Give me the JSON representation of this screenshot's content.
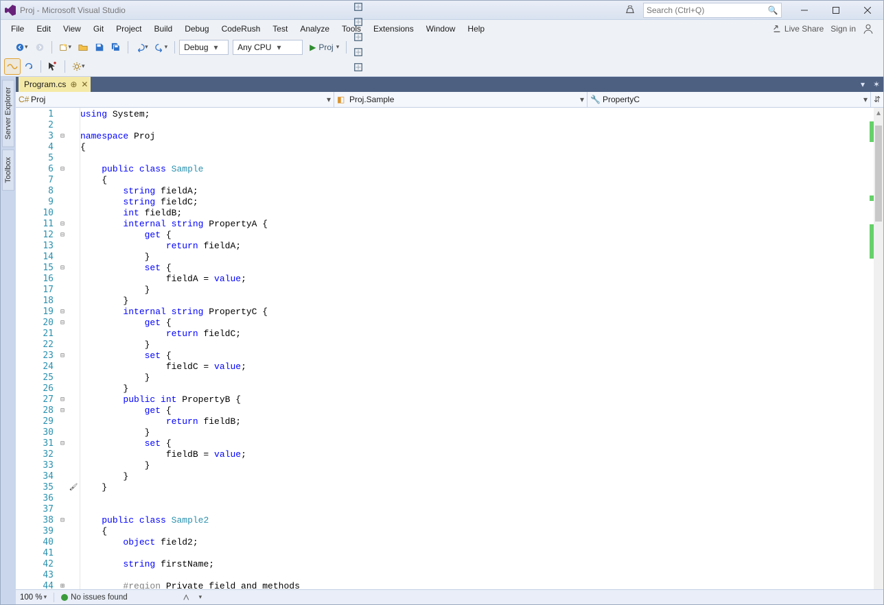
{
  "window": {
    "title": "Proj - Microsoft Visual Studio"
  },
  "titlebar": {
    "search_placeholder": "Search (Ctrl+Q)"
  },
  "menubar": {
    "items": [
      "File",
      "Edit",
      "View",
      "Git",
      "Project",
      "Build",
      "Debug",
      "CodeRush",
      "Test",
      "Analyze",
      "Tools",
      "Extensions",
      "Window",
      "Help"
    ],
    "live_share": "Live Share",
    "sign_in": "Sign in"
  },
  "toolbar": {
    "configuration": "Debug",
    "platform": "Any CPU",
    "start_label": "Proj"
  },
  "side_tabs": [
    "Server Explorer",
    "Toolbox"
  ],
  "tabs": {
    "active": "Program.cs"
  },
  "navbar": {
    "project": "Proj",
    "namespace": "Proj.Sample",
    "member": "PropertyC"
  },
  "editor": {
    "line_start": 1,
    "fold_markers": {
      "3": "-",
      "6": "-",
      "7": "",
      "11": "-",
      "12": "-",
      "15": "-",
      "19": "-",
      "20": "-",
      "23": "-",
      "27": "-",
      "28": "-",
      "31": "-",
      "38": "-",
      "44": "+"
    },
    "wand_line": 35,
    "lines": [
      [
        [
          "kw",
          "using"
        ],
        [
          "plain",
          " System;"
        ]
      ],
      [],
      [
        [
          "kw",
          "namespace"
        ],
        [
          "plain",
          " Proj"
        ]
      ],
      [
        [
          "plain",
          "{"
        ]
      ],
      [],
      [
        [
          "plain",
          "    "
        ],
        [
          "kw",
          "public"
        ],
        [
          "plain",
          " "
        ],
        [
          "kw",
          "class"
        ],
        [
          "plain",
          " "
        ],
        [
          "type",
          "Sample"
        ]
      ],
      [
        [
          "plain",
          "    {"
        ]
      ],
      [
        [
          "plain",
          "        "
        ],
        [
          "kw",
          "string"
        ],
        [
          "plain",
          " fieldA;"
        ]
      ],
      [
        [
          "plain",
          "        "
        ],
        [
          "kw",
          "string"
        ],
        [
          "plain",
          " fieldC;"
        ]
      ],
      [
        [
          "plain",
          "        "
        ],
        [
          "kw",
          "int"
        ],
        [
          "plain",
          " fieldB;"
        ]
      ],
      [
        [
          "plain",
          "        "
        ],
        [
          "kw",
          "internal"
        ],
        [
          "plain",
          " "
        ],
        [
          "kw",
          "string"
        ],
        [
          "plain",
          " PropertyA {"
        ]
      ],
      [
        [
          "plain",
          "            "
        ],
        [
          "kw",
          "get"
        ],
        [
          "plain",
          " {"
        ]
      ],
      [
        [
          "plain",
          "                "
        ],
        [
          "kw",
          "return"
        ],
        [
          "plain",
          " fieldA;"
        ]
      ],
      [
        [
          "plain",
          "            }"
        ]
      ],
      [
        [
          "plain",
          "            "
        ],
        [
          "kw",
          "set"
        ],
        [
          "plain",
          " {"
        ]
      ],
      [
        [
          "plain",
          "                fieldA = "
        ],
        [
          "kw",
          "value"
        ],
        [
          "plain",
          ";"
        ]
      ],
      [
        [
          "plain",
          "            }"
        ]
      ],
      [
        [
          "plain",
          "        }"
        ]
      ],
      [
        [
          "plain",
          "        "
        ],
        [
          "kw",
          "internal"
        ],
        [
          "plain",
          " "
        ],
        [
          "kw",
          "string"
        ],
        [
          "plain",
          " PropertyC {"
        ]
      ],
      [
        [
          "plain",
          "            "
        ],
        [
          "kw",
          "get"
        ],
        [
          "plain",
          " {"
        ]
      ],
      [
        [
          "plain",
          "                "
        ],
        [
          "kw",
          "return"
        ],
        [
          "plain",
          " fieldC;"
        ]
      ],
      [
        [
          "plain",
          "            }"
        ]
      ],
      [
        [
          "plain",
          "            "
        ],
        [
          "kw",
          "set"
        ],
        [
          "plain",
          " {"
        ]
      ],
      [
        [
          "plain",
          "                fieldC = "
        ],
        [
          "kw",
          "value"
        ],
        [
          "plain",
          ";"
        ]
      ],
      [
        [
          "plain",
          "            }"
        ]
      ],
      [
        [
          "plain",
          "        }"
        ]
      ],
      [
        [
          "plain",
          "        "
        ],
        [
          "kw",
          "public"
        ],
        [
          "plain",
          " "
        ],
        [
          "kw",
          "int"
        ],
        [
          "plain",
          " PropertyB {"
        ]
      ],
      [
        [
          "plain",
          "            "
        ],
        [
          "kw",
          "get"
        ],
        [
          "plain",
          " {"
        ]
      ],
      [
        [
          "plain",
          "                "
        ],
        [
          "kw",
          "return"
        ],
        [
          "plain",
          " fieldB;"
        ]
      ],
      [
        [
          "plain",
          "            }"
        ]
      ],
      [
        [
          "plain",
          "            "
        ],
        [
          "kw",
          "set"
        ],
        [
          "plain",
          " {"
        ]
      ],
      [
        [
          "plain",
          "                fieldB = "
        ],
        [
          "kw",
          "value"
        ],
        [
          "plain",
          ";"
        ]
      ],
      [
        [
          "plain",
          "            }"
        ]
      ],
      [
        [
          "plain",
          "        }"
        ]
      ],
      [
        [
          "plain",
          "    }"
        ]
      ],
      [],
      [],
      [
        [
          "plain",
          "    "
        ],
        [
          "kw",
          "public"
        ],
        [
          "plain",
          " "
        ],
        [
          "kw",
          "class"
        ],
        [
          "plain",
          " "
        ],
        [
          "type",
          "Sample2"
        ]
      ],
      [
        [
          "plain",
          "    {"
        ]
      ],
      [
        [
          "plain",
          "        "
        ],
        [
          "kw",
          "object"
        ],
        [
          "plain",
          " field2;"
        ]
      ],
      [],
      [
        [
          "plain",
          "        "
        ],
        [
          "kw",
          "string"
        ],
        [
          "plain",
          " firstName;"
        ]
      ],
      [],
      [
        [
          "plain",
          "        "
        ],
        [
          "region",
          "#region"
        ],
        [
          "plain",
          " Private field and methods"
        ]
      ]
    ]
  },
  "statusbar": {
    "zoom": "100 %",
    "issues": "No issues found"
  }
}
